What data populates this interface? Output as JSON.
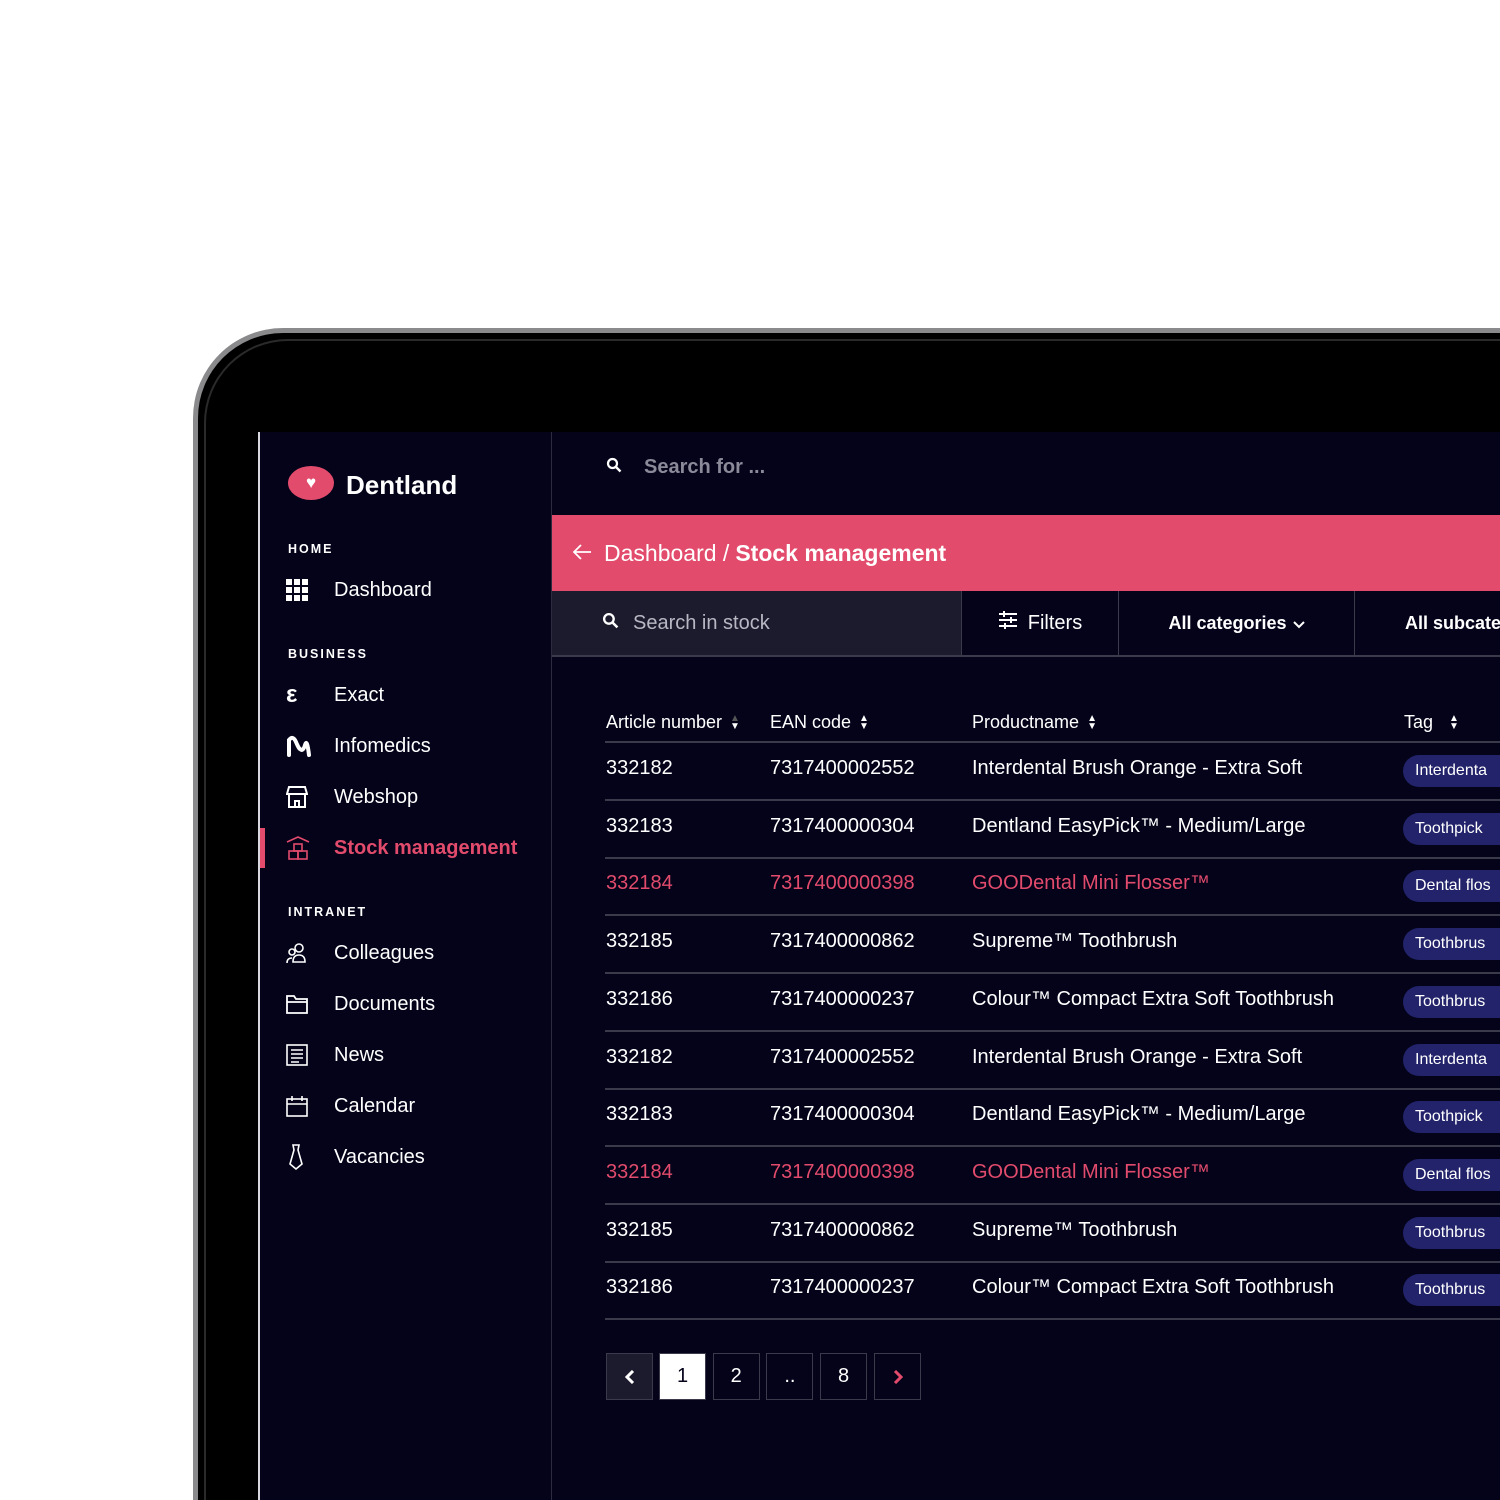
{
  "app": {
    "brand": "Dentland",
    "top_search_placeholder": "Search for ..."
  },
  "sidebar": {
    "sections": [
      {
        "title": "HOME",
        "items": [
          {
            "label": "Dashboard",
            "icon": "grid-icon"
          }
        ]
      },
      {
        "title": "BUSINESS",
        "items": [
          {
            "label": "Exact",
            "icon": "exact-icon"
          },
          {
            "label": "Infomedics",
            "icon": "infomedics-icon"
          },
          {
            "label": "Webshop",
            "icon": "store-icon"
          },
          {
            "label": "Stock management",
            "icon": "boxes-icon",
            "active": true
          }
        ]
      },
      {
        "title": "INTRANET",
        "items": [
          {
            "label": "Colleagues",
            "icon": "users-icon"
          },
          {
            "label": "Documents",
            "icon": "folder-icon"
          },
          {
            "label": "News",
            "icon": "newspaper-icon"
          },
          {
            "label": "Calendar",
            "icon": "calendar-icon"
          },
          {
            "label": "Vacancies",
            "icon": "tie-icon"
          }
        ]
      }
    ]
  },
  "header": {
    "crumb": "Dashboard /",
    "title": "Stock management"
  },
  "toolbar": {
    "search_placeholder": "Search in stock",
    "filters": "Filters",
    "categories": "All categories",
    "subcategories": "All subcate"
  },
  "table": {
    "columns": [
      "Article number",
      "EAN code",
      "Productname",
      "Tag"
    ],
    "rows": [
      {
        "article": "332182",
        "ean": "7317400002552",
        "name": "Interdental Brush Orange - Extra Soft",
        "tag": "Interdenta",
        "highlight": false
      },
      {
        "article": "332183",
        "ean": "7317400000304",
        "name": "Dentland EasyPick™ - Medium/Large",
        "tag": "Toothpick",
        "highlight": false
      },
      {
        "article": "332184",
        "ean": "7317400000398",
        "name": "GOODental Mini Flosser™",
        "tag": "Dental flos",
        "highlight": true
      },
      {
        "article": "332185",
        "ean": "7317400000862",
        "name": "Supreme™ Toothbrush",
        "tag": "Toothbrus",
        "highlight": false
      },
      {
        "article": "332186",
        "ean": "7317400000237",
        "name": "Colour™ Compact Extra Soft Toothbrush",
        "tag": "Toothbrus",
        "highlight": false
      },
      {
        "article": "332182",
        "ean": "7317400002552",
        "name": "Interdental Brush Orange - Extra Soft",
        "tag": "Interdenta",
        "highlight": false
      },
      {
        "article": "332183",
        "ean": "7317400000304",
        "name": "Dentland EasyPick™ - Medium/Large",
        "tag": "Toothpick",
        "highlight": false
      },
      {
        "article": "332184",
        "ean": "7317400000398",
        "name": "GOODental Mini Flosser™",
        "tag": "Dental flos",
        "highlight": true
      },
      {
        "article": "332185",
        "ean": "7317400000862",
        "name": "Supreme™ Toothbrush",
        "tag": "Toothbrus",
        "highlight": false
      },
      {
        "article": "332186",
        "ean": "7317400000237",
        "name": "Colour™ Compact Extra Soft Toothbrush",
        "tag": "Toothbrus",
        "highlight": false
      }
    ]
  },
  "pagination": {
    "pages": [
      "1",
      "2",
      "..",
      "8"
    ],
    "current": "1"
  },
  "colors": {
    "accent": "#e24b6c",
    "background": "#04031a",
    "tag": "#22236a"
  }
}
